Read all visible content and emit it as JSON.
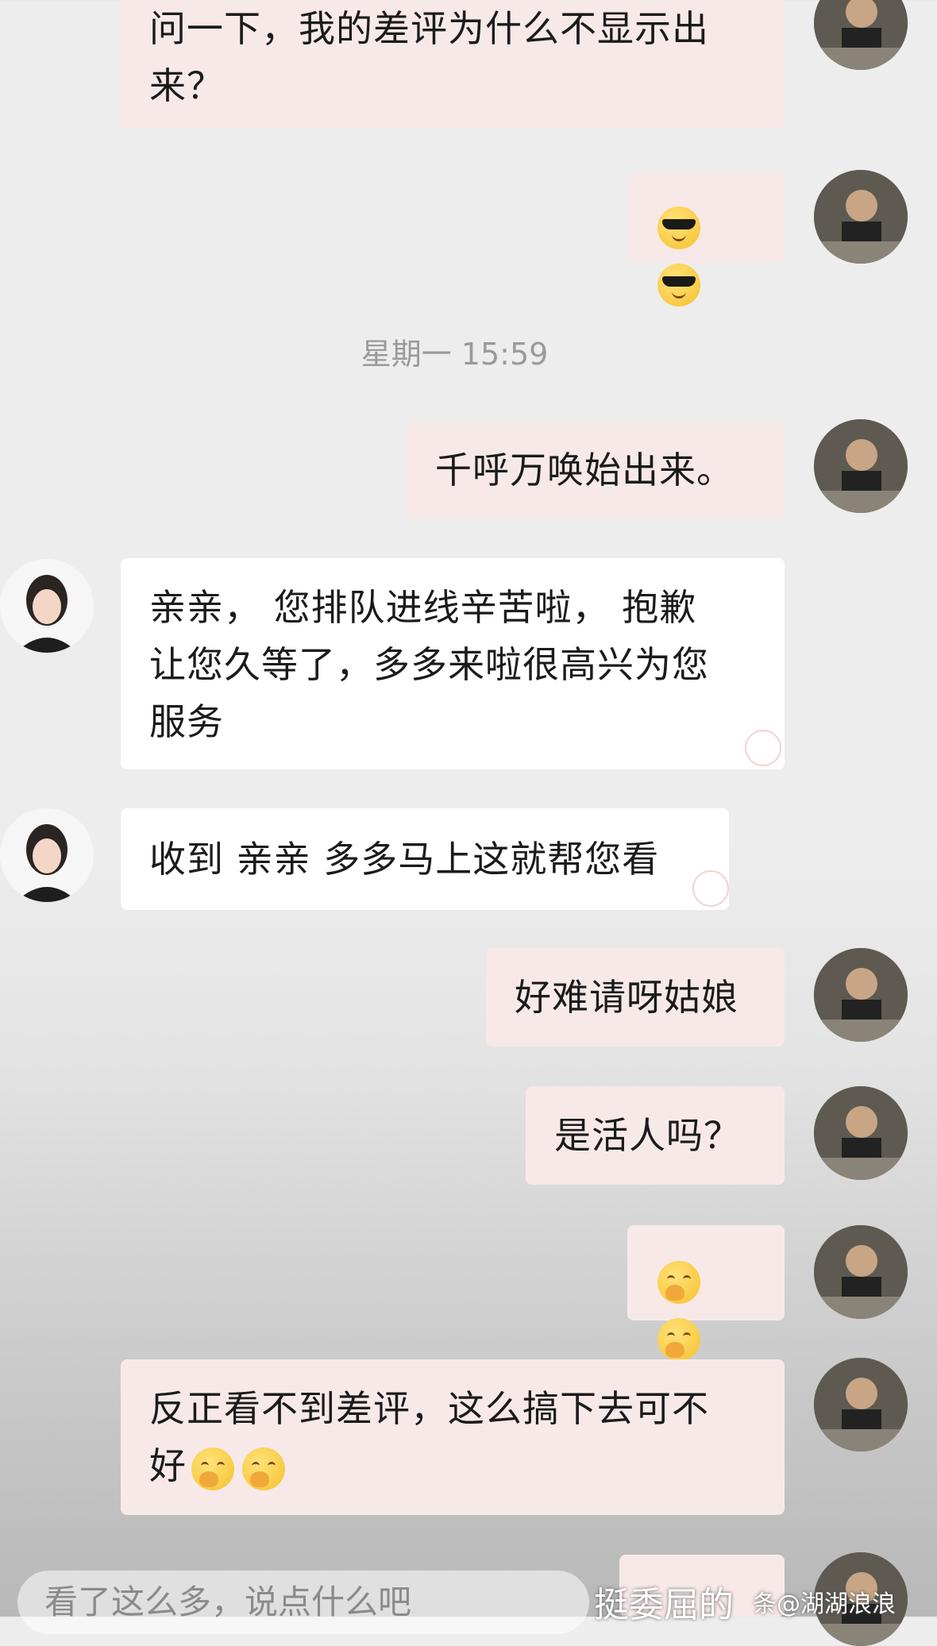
{
  "messages": [
    {
      "side": "me",
      "text": "问一下，我的差评为什么不显示出来？"
    },
    {
      "side": "me",
      "emoji": [
        "cool-face",
        "cool-face"
      ]
    },
    {
      "timestamp": "星期一 15:59"
    },
    {
      "side": "me",
      "text": "千呼万唤始出来。"
    },
    {
      "side": "agent",
      "text": "亲亲， 您排队进线辛苦啦， 抱歉让您久等了，多多来啦很高兴为您服务"
    },
    {
      "side": "agent",
      "text": "收到 亲亲 多多马上这就帮您看"
    },
    {
      "side": "me",
      "text": "好难请呀姑娘"
    },
    {
      "side": "me",
      "text": "是活人吗？"
    },
    {
      "side": "me",
      "emoji": [
        "hand-over-mouth",
        "hand-over-mouth"
      ]
    },
    {
      "side": "me",
      "text": "反正看不到差评，这么搞下去可不好"
    }
  ],
  "lines": {
    "m0a": "问一下，我的差评为什么不显示出",
    "m0b": "来？",
    "ts": "星期一 15:59",
    "m3": "千呼万唤始出来。",
    "m4a": "亲亲， 您排队进线辛苦啦， 抱歉",
    "m4b": "让您久等了，多多来啦很高兴为您",
    "m4c": "服务",
    "m5": "收到 亲亲 多多马上这就帮您看",
    "m6": "好难请呀姑娘",
    "m7": "是活人吗？",
    "m9a": "反正看不到差评，这么搞下去可不",
    "m9b": "好"
  },
  "input": {
    "placeholder": "看了这么多，说点什么吧"
  },
  "overlay": {
    "caption": "挺委屈的",
    "watermark": "条@湖湖浪浪"
  },
  "colors": {
    "my_bubble": "#f8e9e9",
    "agent_bubble": "#ffffff",
    "timestamp": "#9a9a9a"
  }
}
